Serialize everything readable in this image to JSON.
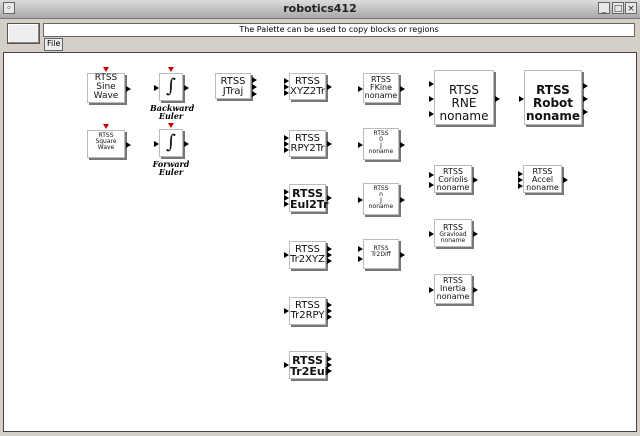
{
  "window": {
    "title": "robotics412"
  },
  "toolbar": {
    "message": "The Palette can be used to copy blocks or regions",
    "file_label": "File"
  },
  "blocks": {
    "sinewave": [
      "RTSS",
      "Sine",
      "Wave"
    ],
    "squarewave": [
      "RTSS",
      "Square",
      "Wave"
    ],
    "backward_euler": [
      "Backward",
      "Euler"
    ],
    "forward_euler": [
      "Forward",
      "Euler"
    ],
    "jtraj": [
      "RTSS",
      "JTraj"
    ],
    "xyz2tr": [
      "RTSS",
      "XYZ2Tr"
    ],
    "rpy2tr": [
      "RTSS",
      "RPY2Tr"
    ],
    "eul2tr": [
      "RTSS",
      "Eul2Tr"
    ],
    "tr2xyz": [
      "RTSS",
      "Tr2XYZ"
    ],
    "tr2rpy": [
      "RTSS",
      "Tr2RPY"
    ],
    "tr2eul": [
      "RTSS",
      "Tr2Eul"
    ],
    "fkine": [
      "RTSS",
      "FKine",
      "noname"
    ],
    "jacob0": [
      "RTSS",
      "0",
      "J",
      "noname"
    ],
    "jacobn": [
      "RTSS",
      "n",
      "J",
      "noname"
    ],
    "tr2diff": [
      "RTSS",
      "Tr2Diff"
    ],
    "rne": [
      "RTSS",
      "RNE",
      "noname"
    ],
    "robot": [
      "RTSS",
      "Robot",
      "noname"
    ],
    "coriolis": [
      "RTSS",
      "Coriolis",
      "noname"
    ],
    "gravload": [
      "RTSS",
      "Gravload",
      "noname"
    ],
    "inertia": [
      "RTSS",
      "Inertia",
      "noname"
    ],
    "accel": [
      "RTSS",
      "Accel",
      "noname"
    ]
  }
}
